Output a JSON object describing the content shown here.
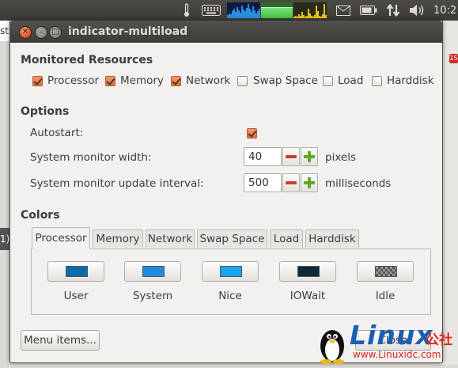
{
  "panel": {
    "icons": [
      "thermometer-icon",
      "keyboard-icon",
      "email-icon",
      "battery-icon",
      "network-arrows-icon",
      "volume-icon"
    ],
    "time": "10:2"
  },
  "background": {
    "left_text_top": "st",
    "left_text_mid": "1)",
    "right_badge": "15"
  },
  "window": {
    "title": "indicator-multiload"
  },
  "monitored": {
    "heading": "Monitored Resources",
    "items": [
      {
        "label": "Processor",
        "checked": true
      },
      {
        "label": "Memory",
        "checked": true
      },
      {
        "label": "Network",
        "checked": true
      },
      {
        "label": "Swap Space",
        "checked": false
      },
      {
        "label": "Load",
        "checked": false
      },
      {
        "label": "Harddisk",
        "checked": false
      }
    ]
  },
  "options": {
    "heading": "Options",
    "autostart_label": "Autostart:",
    "autostart_checked": true,
    "width_label": "System monitor width:",
    "width_value": "40",
    "width_unit": "pixels",
    "interval_label": "System monitor update interval:",
    "interval_value": "500",
    "interval_unit": "milliseconds"
  },
  "colors": {
    "heading": "Colors",
    "tabs": [
      "Processor",
      "Memory",
      "Network",
      "Swap Space",
      "Load",
      "Harddisk"
    ],
    "active_tab": "Processor",
    "swatches": [
      {
        "label": "User",
        "color": "#0a6cb0"
      },
      {
        "label": "System",
        "color": "#1b8de0"
      },
      {
        "label": "Nice",
        "color": "#19a3f2"
      },
      {
        "label": "IOWait",
        "color": "#0c2a36"
      },
      {
        "label": "Idle",
        "color": "checker"
      }
    ]
  },
  "footer": {
    "menu_items_label": "Menu items...",
    "close_label": "Close"
  },
  "watermark": {
    "text": "Linux",
    "cn": "公社",
    "url": "www.Linuxidc.com"
  }
}
